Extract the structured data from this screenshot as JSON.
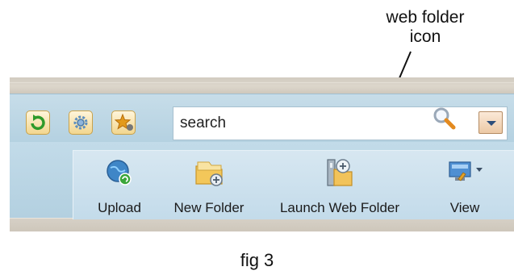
{
  "annotation": {
    "line1": "web folder",
    "line2": "icon"
  },
  "quick_buttons": [
    {
      "icon": "refresh-icon"
    },
    {
      "icon": "gear-icon"
    },
    {
      "icon": "star-icon"
    }
  ],
  "search": {
    "value": "search",
    "search_icon": "magnifier-icon",
    "dropdown_icon": "chevron-down-icon"
  },
  "toolbar": {
    "upload_label": "Upload",
    "new_folder_label": "New Folder",
    "launch_web_folder_label": "Launch Web Folder",
    "view_label": "View"
  },
  "caption": "fig 3"
}
